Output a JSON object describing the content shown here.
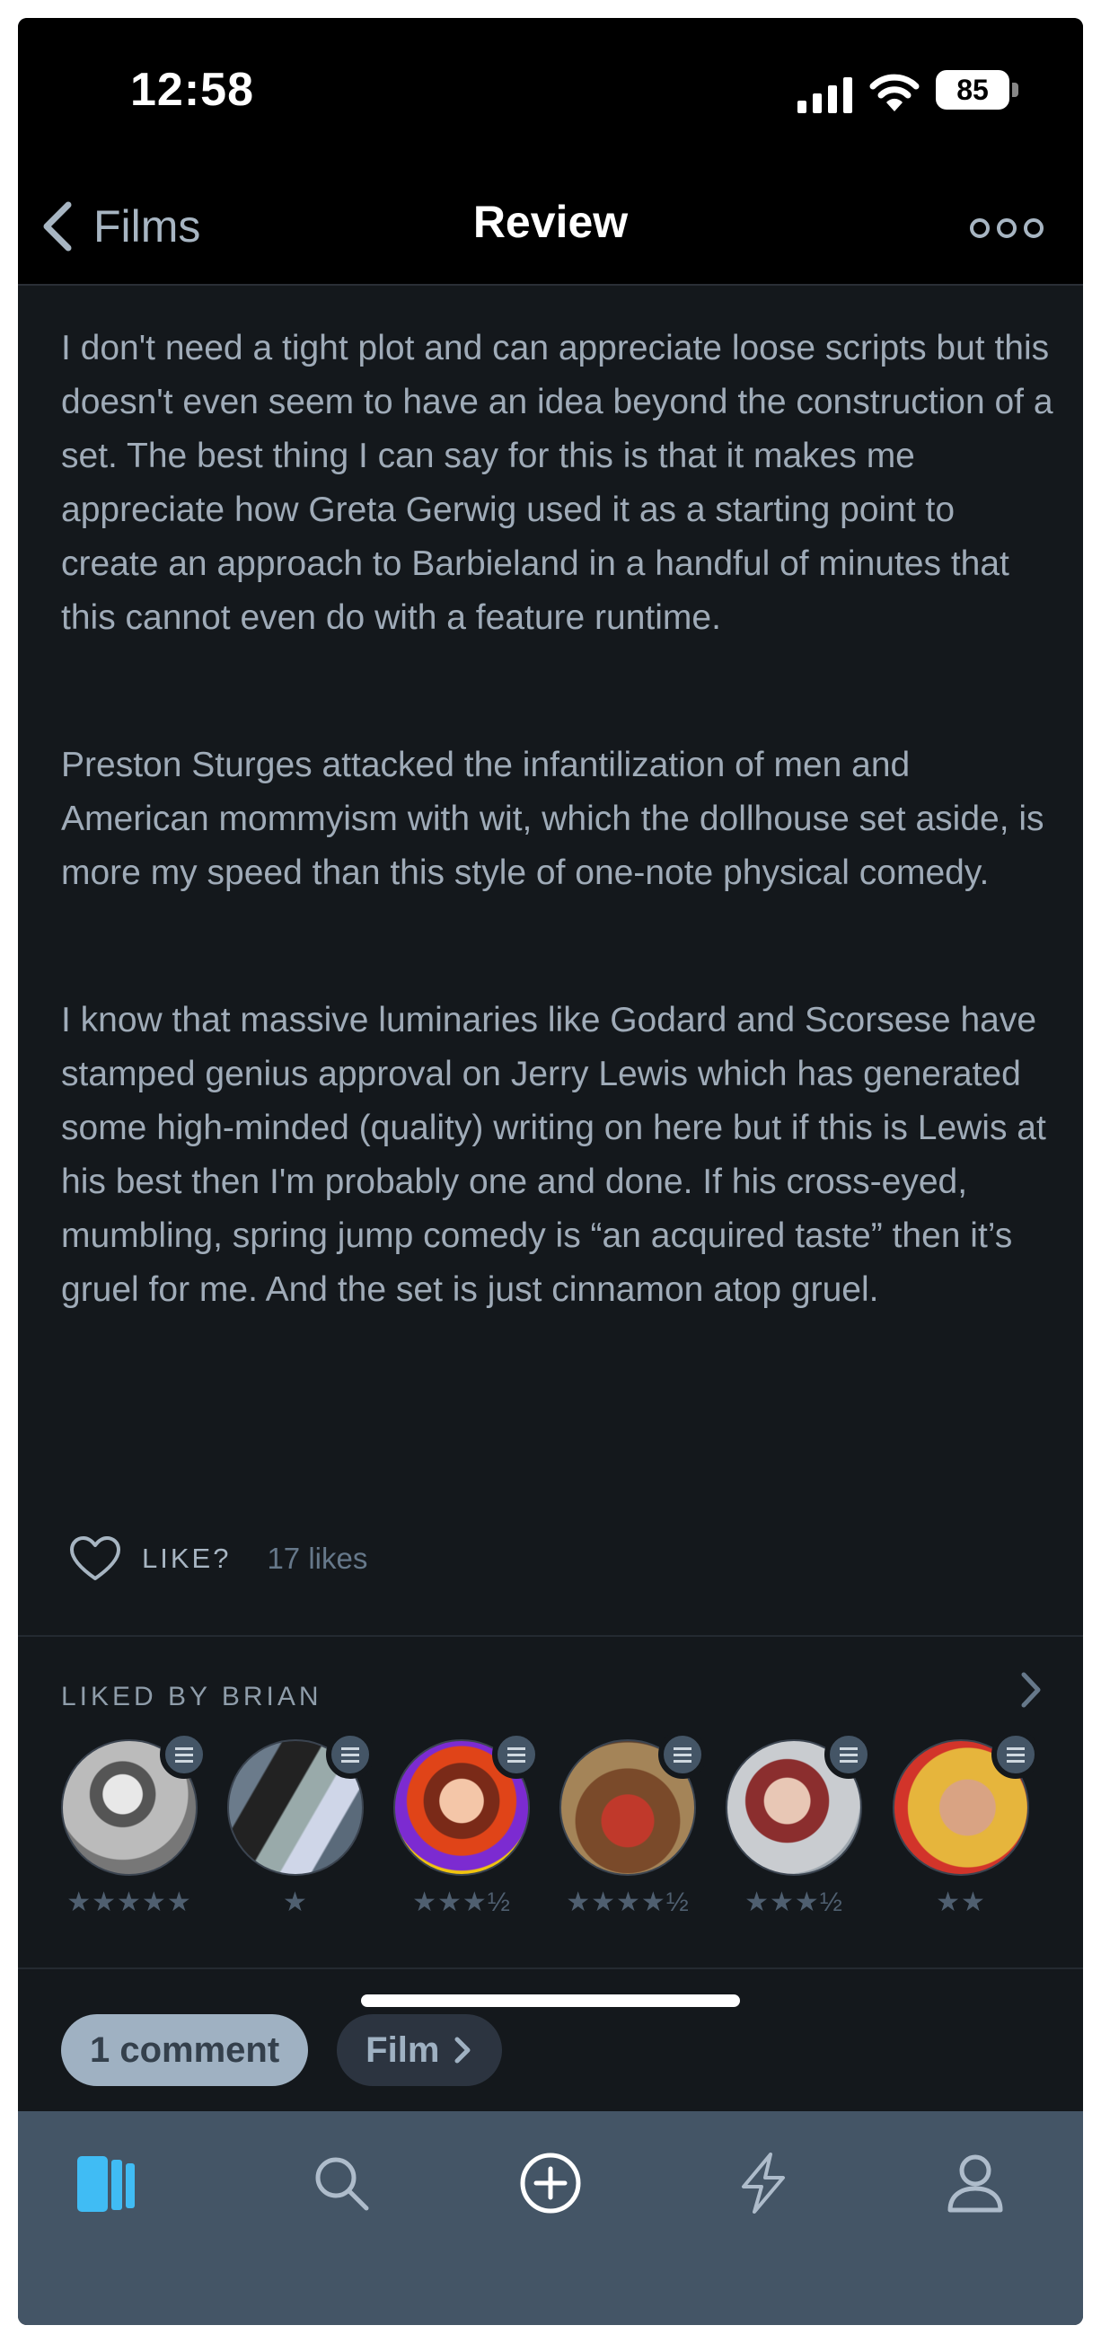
{
  "status_bar": {
    "time": "12:58",
    "battery": "85"
  },
  "nav": {
    "back_label": "Films",
    "title": "Review"
  },
  "review": {
    "paragraphs": [
      "I don't need a tight plot and can appreciate loose scripts but this doesn't even seem to have an idea beyond the construction of a set. The best thing I can say for this is that it makes me appreciate how Greta Gerwig used it as a starting point to create an approach to Barbieland in a handful of minutes that this cannot even do with a feature runtime.",
      "Preston Sturges attacked the infantilization of men and American mommyism with wit, which the dollhouse set aside, is more my speed than this style of one-note physical comedy.",
      "I know that massive luminaries like Godard and Scorsese have stamped genius approval on Jerry Lewis which has generated some high-minded (quality) writing on here but if this is Lewis at his best then I'm probably one and done. If his cross-eyed, mumbling, spring jump comedy is “an acquired taste” then it’s gruel for me. And the set is just cinnamon atop gruel."
    ]
  },
  "like": {
    "label": "LIKE?",
    "count": "17 likes"
  },
  "liked_by": {
    "heading": "LIKED BY BRIAN",
    "items": [
      {
        "rating": "★★★★★"
      },
      {
        "rating": "★"
      },
      {
        "rating": "★★★½"
      },
      {
        "rating": "★★★★½"
      },
      {
        "rating": "★★★½"
      },
      {
        "rating": "★★"
      }
    ]
  },
  "chips": {
    "comments": "1 comment",
    "film": "Film"
  },
  "tabs": [
    "activity-icon",
    "search-icon",
    "add-icon",
    "bolt-icon",
    "profile-icon"
  ],
  "colors": {
    "background": "#14181c",
    "tab_bar": "#445566",
    "accent_blue": "#40bcf4",
    "text": "#9fabb8"
  }
}
